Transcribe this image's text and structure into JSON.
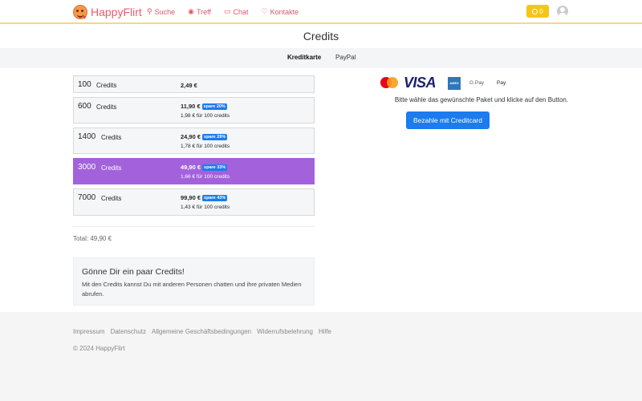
{
  "brand": {
    "name": "HappyFlirt"
  },
  "nav": {
    "items": [
      {
        "label": "Suche",
        "icon": "search-icon"
      },
      {
        "label": "Treff",
        "icon": "eye-icon"
      },
      {
        "label": "Chat",
        "icon": "chat-icon"
      },
      {
        "label": "Kontakte",
        "icon": "heart-icon"
      }
    ],
    "coins": "0"
  },
  "page": {
    "title": "Credits"
  },
  "tabs": [
    {
      "label": "Kreditkarte",
      "active": true
    },
    {
      "label": "PayPal",
      "active": false
    }
  ],
  "unit_label": "Credits",
  "packages": [
    {
      "amount": "100",
      "price": "2,49 €",
      "badge": "",
      "per100": ""
    },
    {
      "amount": "600",
      "price": "11,90 €",
      "badge": "spare 20%",
      "per100": "1,98 € für 100 credits"
    },
    {
      "amount": "1400",
      "price": "24,90 €",
      "badge": "spare 29%",
      "per100": "1,78 € für 100 credits"
    },
    {
      "amount": "3000",
      "price": "49,90 €",
      "badge": "spare 33%",
      "per100": "1,66 € für 100 credits",
      "selected": true
    },
    {
      "amount": "7000",
      "price": "99,90 €",
      "badge": "spare 43%",
      "per100": "1,43 € für 100 credits"
    }
  ],
  "total": "Total: 49,90 €",
  "info": {
    "title": "Gönne Dir ein paar Credits!",
    "text": "Mit den Credits kannst Du mit anderen Personen chatten und ihre privaten Medien abrufen."
  },
  "payment": {
    "logos": {
      "visa": "VISA",
      "amex": "AMERICAN EXPRESS",
      "gpay": "G Pay",
      "apay": " Pay"
    },
    "hint": "Bitte wähle das gewünschte Paket und klicke auf den Button.",
    "button": "Bezahle mit Creditcard"
  },
  "footer": {
    "links": [
      "Impressum",
      "Datenschutz",
      "Allgemeine Geschäftsbedingungen",
      "Widerrufsbelehrung",
      "Hilfe"
    ],
    "copyright": "© 2024 HappyFlirt"
  },
  "colors": {
    "brand": "#ef5a6f",
    "selected": "#a362dc",
    "primary": "#1b7bef",
    "coins": "#f5c518"
  }
}
